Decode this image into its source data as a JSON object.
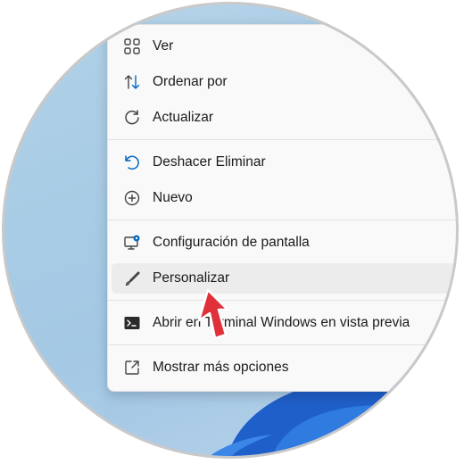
{
  "context_menu": {
    "items": [
      {
        "label": "Ver",
        "icon": "grid-view-icon"
      },
      {
        "label": "Ordenar por",
        "icon": "sort-arrows-icon"
      },
      {
        "label": "Actualizar",
        "icon": "refresh-icon"
      },
      {
        "label": "Deshacer Eliminar",
        "icon": "undo-icon"
      },
      {
        "label": "Nuevo",
        "icon": "plus-circle-icon"
      },
      {
        "label": "Configuración de pantalla",
        "icon": "display-settings-icon"
      },
      {
        "label": "Personalizar",
        "icon": "brush-icon"
      },
      {
        "label": "Abrir en Terminal Windows en vista previa",
        "icon": "terminal-icon"
      },
      {
        "label": "Mostrar más opciones",
        "icon": "more-options-icon"
      }
    ],
    "hovered_item": "Personalizar"
  },
  "colors": {
    "accent": "#0067c0",
    "pointer_arrow": "#e0303a",
    "menu_background": "#f9f9f9",
    "hover_background": "#ececec"
  }
}
